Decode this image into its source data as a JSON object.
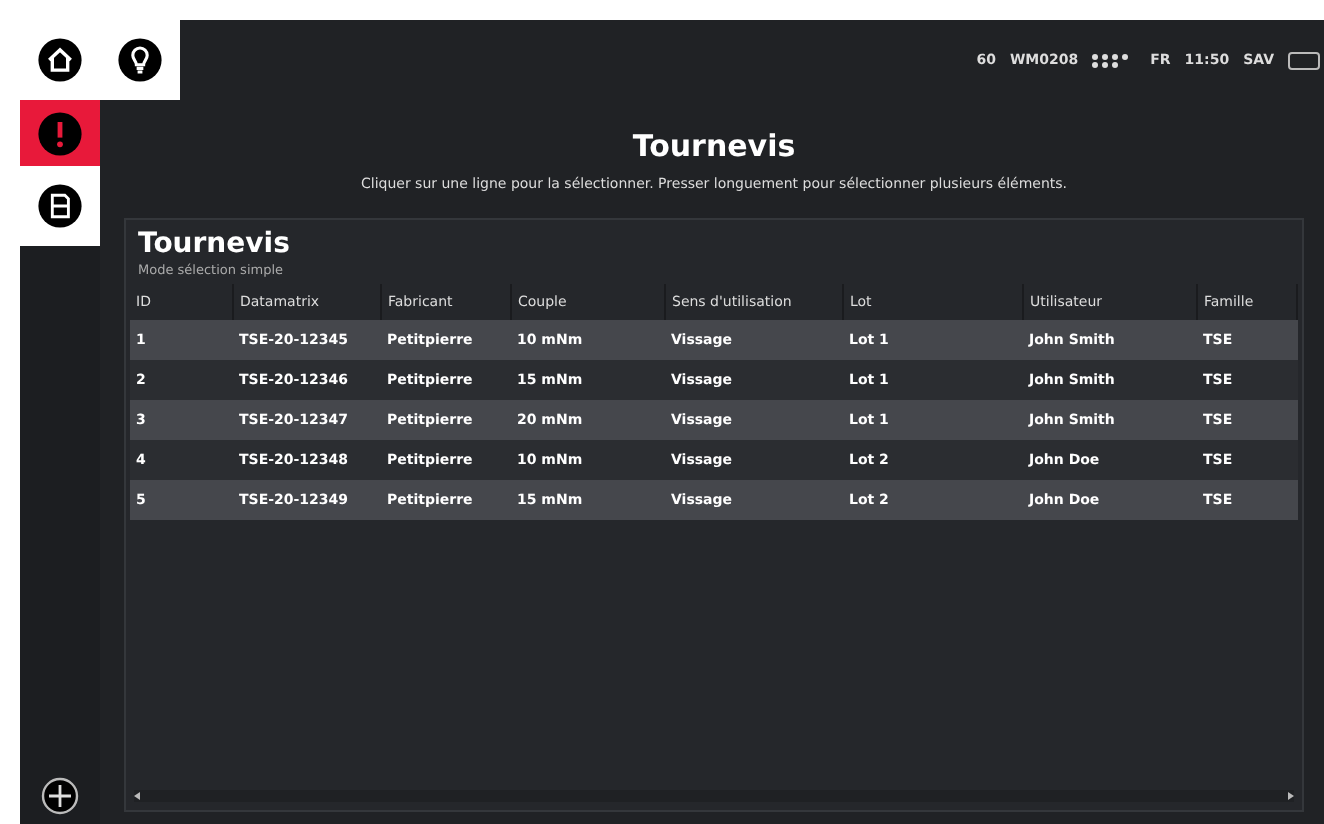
{
  "top_buttons": [
    {
      "kind": "home",
      "selected": false
    },
    {
      "kind": "bulb",
      "selected": false
    }
  ],
  "sidebar": {
    "items": [
      {
        "kind": "alert",
        "selected": true
      },
      {
        "kind": "document",
        "selected": false
      }
    ],
    "bottom": {
      "kind": "plus"
    }
  },
  "status_bar": {
    "items": [
      {
        "kind": "text",
        "text": "60"
      },
      {
        "kind": "text",
        "text": "WM0208"
      },
      {
        "kind": "dots"
      },
      {
        "kind": "text",
        "text": "FR"
      },
      {
        "kind": "text",
        "text": "11:50"
      },
      {
        "kind": "text",
        "text": "SAV"
      },
      {
        "kind": "battery"
      }
    ]
  },
  "page": {
    "title": "Tournevis",
    "hint": "Cliquer sur une ligne pour la sélectionner. Presser longuement pour sélectionner plusieurs éléments."
  },
  "table": {
    "title": "Tournevis",
    "subtitle": "Mode sélection simple",
    "columns": [
      "ID",
      "Datamatrix",
      "Fabricant",
      "Couple",
      "Sens d'utilisation",
      "Lot",
      "Utilisateur",
      "Famille"
    ],
    "rows": [
      {
        "cells": [
          "1",
          "TSE-20-12345",
          "Petitpierre",
          "10 mNm",
          "Vissage",
          "Lot 1",
          "John Smith",
          "TSE"
        ]
      },
      {
        "cells": [
          "2",
          "TSE-20-12346",
          "Petitpierre",
          "15 mNm",
          "Vissage",
          "Lot 1",
          "John Smith",
          "TSE"
        ]
      },
      {
        "cells": [
          "3",
          "TSE-20-12347",
          "Petitpierre",
          "20 mNm",
          "Vissage",
          "Lot 1",
          "John Smith",
          "TSE"
        ]
      },
      {
        "cells": [
          "4",
          "TSE-20-12348",
          "Petitpierre",
          "10 mNm",
          "Vissage",
          "Lot 2",
          "John Doe",
          "TSE"
        ]
      },
      {
        "cells": [
          "5",
          "TSE-20-12349",
          "Petitpierre",
          "15 mNm",
          "Vissage",
          "Lot 2",
          "John Doe",
          "TSE"
        ]
      }
    ]
  }
}
